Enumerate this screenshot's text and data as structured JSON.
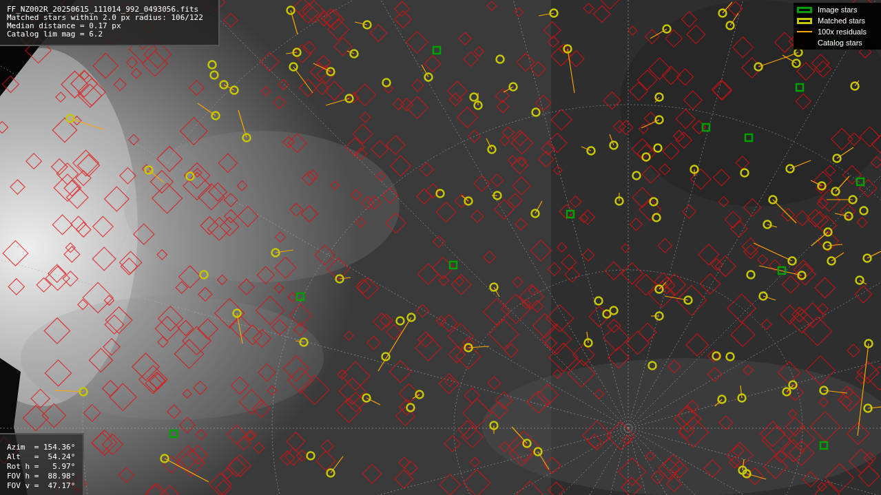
{
  "file_info": {
    "lines": [
      "FF_NZ002R_20250615_111014_992_0493056.fits",
      "Matched stars within 2.0 px radius: 106/122",
      "Median distance = 0.17 px",
      "Catalog lim mag = 6.2"
    ]
  },
  "legend": {
    "items": [
      {
        "kind": "box",
        "color": "#00a000",
        "label": "Image stars"
      },
      {
        "kind": "box",
        "color": "#c8c800",
        "label": "Matched stars"
      },
      {
        "kind": "line",
        "color": "#ffa500",
        "label": "100x residuals"
      },
      {
        "kind": "blank",
        "label": "Catalog stars"
      }
    ]
  },
  "pointing": {
    "lines": [
      "Azim  = 154.36°",
      "Alt   =  54.24°",
      "Rot h =   5.97°",
      "FOV h =  88.98°",
      "FOV v =  47.17°"
    ]
  }
}
